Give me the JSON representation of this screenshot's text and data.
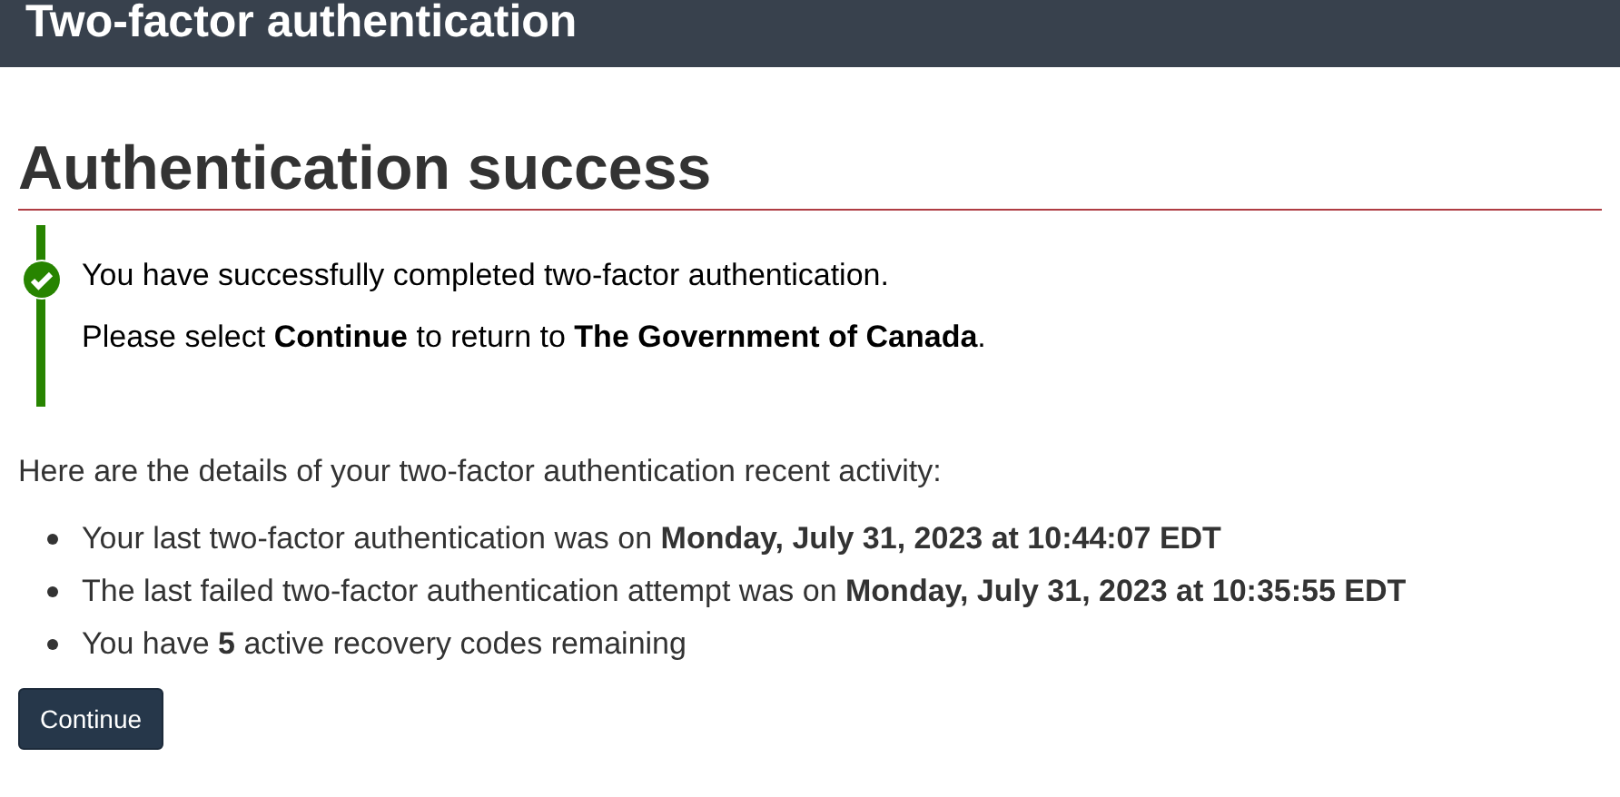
{
  "header": {
    "title": "Two-factor authentication"
  },
  "heading": "Authentication success",
  "alert": {
    "kind": "success",
    "lines": [
      "You have successfully completed two-factor authentication.",
      "Please select **Continue** to return to **The Government of Canada**."
    ]
  },
  "intro": "Here are the details of your two-factor authentication recent activity:",
  "details": [
    "Your last two-factor authentication was on **Monday, July 31, 2023 at 10:44:07 EDT**",
    "The last failed two-factor authentication attempt was on **Monday, July 31, 2023 at 10:35:55 EDT**",
    "You have **5** active recovery codes remaining"
  ],
  "buttons": [
    "Continue"
  ]
}
